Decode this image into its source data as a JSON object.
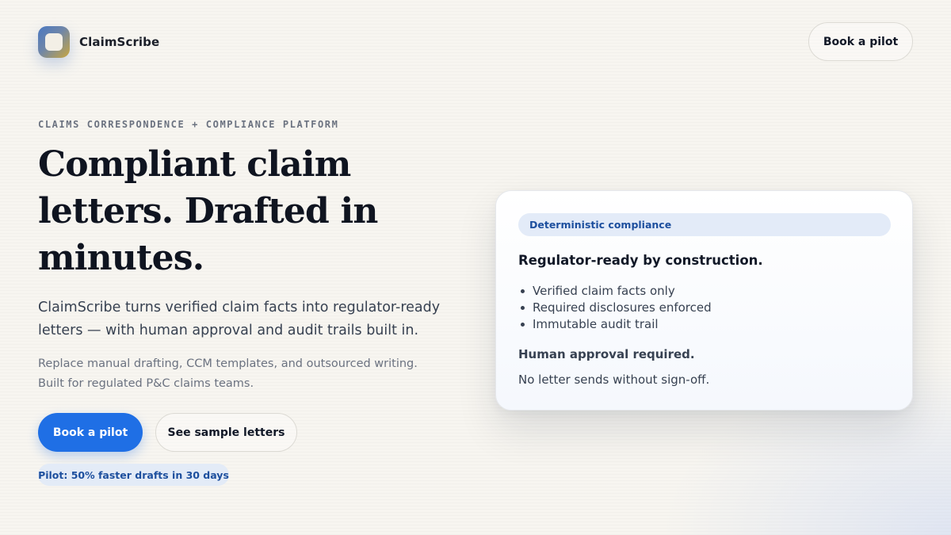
{
  "brand": {
    "name": "ClaimScribe"
  },
  "nav": {
    "cta_label": "Book a pilot"
  },
  "hero": {
    "eyebrow": "CLAIMS CORRESPONDENCE + COMPLIANCE PLATFORM",
    "headline": "Compliant claim letters. Drafted in minutes.",
    "lead": "ClaimScribe turns verified claim facts into regulator-ready letters — with human approval and audit trails built in.",
    "sub_line_1": "Replace manual drafting, CCM templates, and outsourced writing.",
    "sub_line_2": "Built for regulated P&C claims teams.",
    "primary_cta": "Book a pilot",
    "secondary_cta": "See sample letters",
    "pilot_badge": "Pilot: 50% faster drafts in 30 days"
  },
  "card": {
    "pill": "Deterministic compliance",
    "title": "Regulator-ready by construction.",
    "items": [
      {
        "label": "Verified claim facts only"
      },
      {
        "label": "Required disclosures enforced"
      },
      {
        "label": "Immutable audit trail"
      }
    ],
    "subhead": "Human approval required.",
    "note": "No letter sends without sign-off."
  },
  "colors": {
    "accent": "#1f6fe5",
    "badge_bg": "#e3ebf7",
    "badge_text": "#1d4f9e",
    "background": "#f7f5f0"
  }
}
